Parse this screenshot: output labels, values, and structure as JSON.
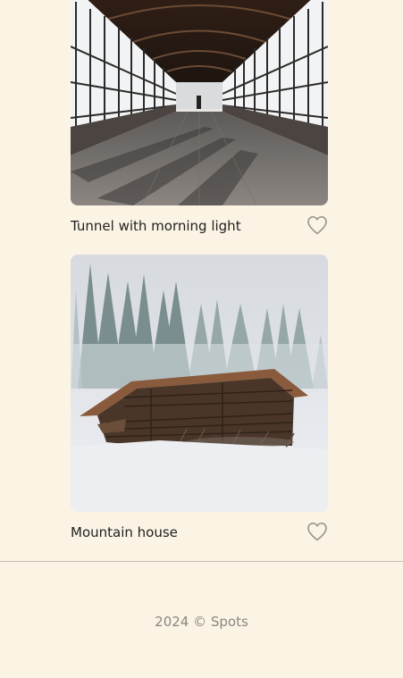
{
  "cards": [
    {
      "title": "Tunnel with morning light",
      "liked": false,
      "image_icon": "photo-tunnel"
    },
    {
      "title": "Mountain house",
      "liked": false,
      "image_icon": "photo-mountain-house"
    }
  ],
  "footer": {
    "text": "2024 © Spots"
  },
  "colors": {
    "background": "#fbf4e5",
    "heart": "#9c9890",
    "text": "#212121",
    "muted": "#8a8680"
  }
}
